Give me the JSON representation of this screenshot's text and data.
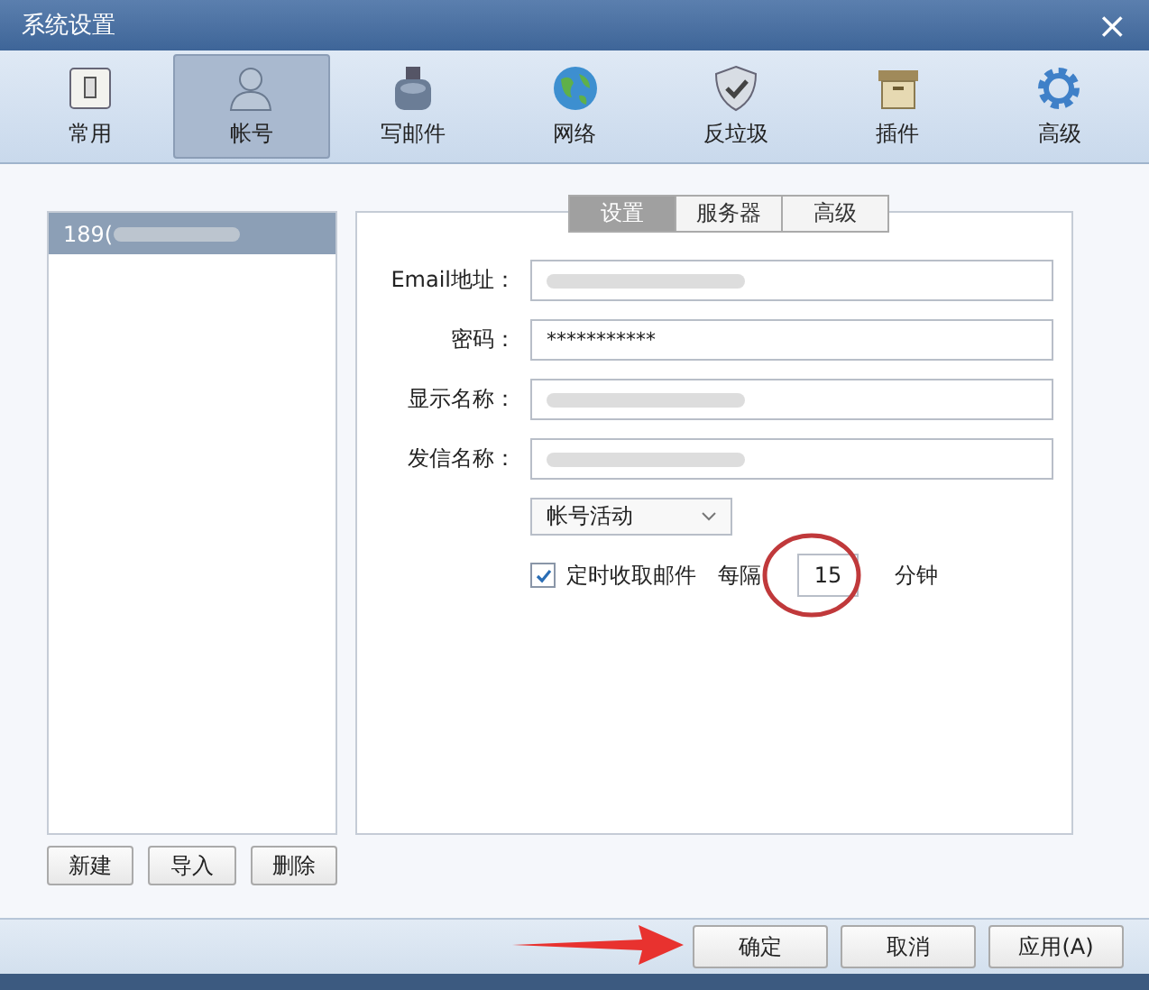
{
  "window": {
    "title": "系统设置",
    "close": "×"
  },
  "toolbar": [
    {
      "label": "常用",
      "selected": false
    },
    {
      "label": "帐号",
      "selected": true
    },
    {
      "label": "写邮件",
      "selected": false
    },
    {
      "label": "网络",
      "selected": false
    },
    {
      "label": "反垃圾",
      "selected": false
    },
    {
      "label": "插件",
      "selected": false
    },
    {
      "label": "高级",
      "selected": false
    }
  ],
  "accounts": [
    {
      "label": "189(",
      "redacted": true,
      "selected": true
    }
  ],
  "account_buttons": [
    "新建",
    "导入",
    "删除"
  ],
  "tabs": [
    {
      "label": "设置",
      "selected": true
    },
    {
      "label": "服务器",
      "selected": false
    },
    {
      "label": "高级",
      "selected": false
    }
  ],
  "fields": [
    {
      "label": "Email地址：",
      "redacted": true
    },
    {
      "label": "密码：",
      "value": "***********",
      "redacted": false
    },
    {
      "label": "显示名称：",
      "redacted": true
    },
    {
      "label": "发信名称：",
      "redacted": true
    }
  ],
  "status_dropdown": {
    "value": "帐号活动"
  },
  "auto_fetch": {
    "label": "定时收取邮件",
    "checked": true,
    "every": "每隔",
    "interval": "15",
    "unit": "分钟"
  },
  "annotations": {
    "circle": true,
    "arrow": true
  },
  "buttons": [
    "确定",
    "取消",
    "应用(A)"
  ]
}
